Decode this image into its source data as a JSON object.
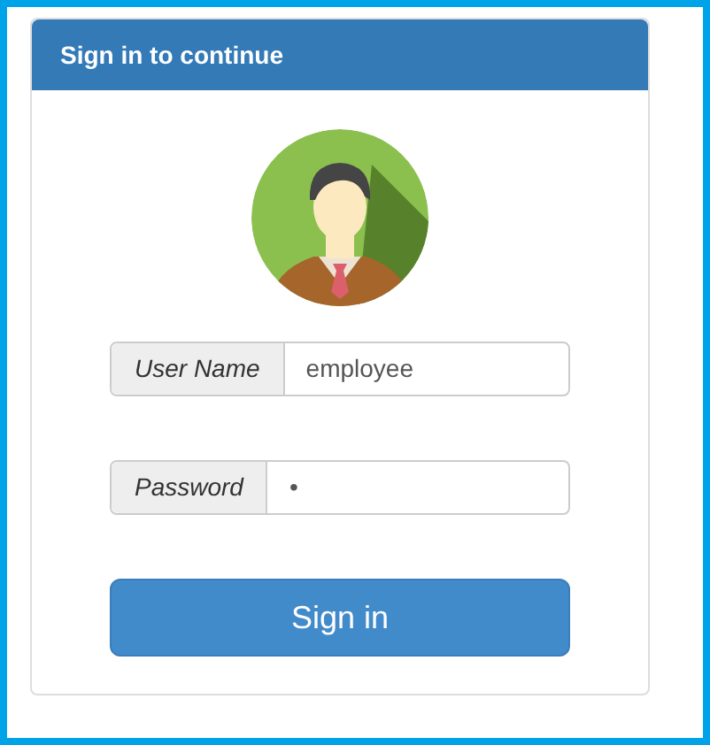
{
  "panel": {
    "title": "Sign in to continue"
  },
  "avatar": {
    "kind": "user"
  },
  "fields": [
    {
      "label": "User Name",
      "value": "employee"
    },
    {
      "label": "Password",
      "value": "•"
    }
  ],
  "submit": {
    "label": "Sign in"
  }
}
